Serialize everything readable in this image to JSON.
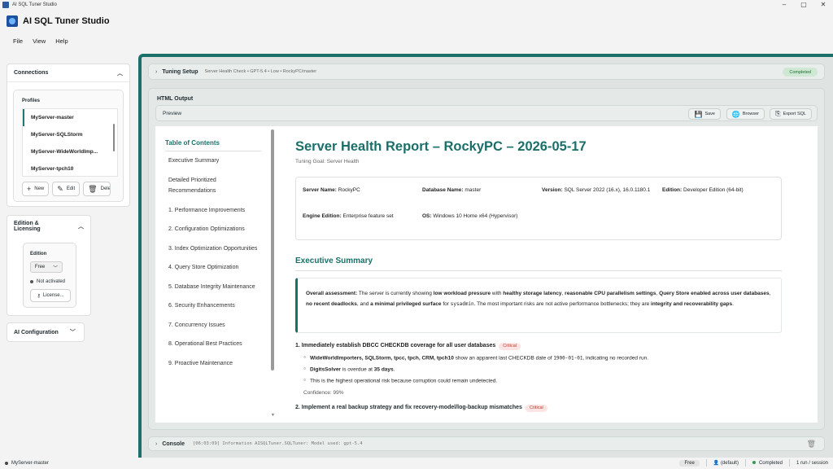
{
  "window": {
    "title": "AI SQL Tuner Studio",
    "controls": [
      "–",
      "▢",
      "✕"
    ]
  },
  "app": {
    "name": "AI SQL Tuner Studio"
  },
  "menu": [
    "File",
    "View",
    "Help"
  ],
  "connections": {
    "title": "Connections",
    "profiles_label": "Profiles",
    "profiles": [
      "MyServer-master",
      "MyServer-SQLStorm",
      "MyServer-WideWorldImp...",
      "MyServer-tpch10"
    ],
    "selected": "MyServer-master",
    "buttons": {
      "new": "New",
      "edit": "Edit",
      "delete": "Dele"
    }
  },
  "edition": {
    "title": "Edition & Licensing",
    "label": "Edition",
    "value": "Free",
    "status": "Not activated",
    "license_button": "License..."
  },
  "ai_config": {
    "title": "AI Configuration"
  },
  "tuning": {
    "title": "Tuning Setup",
    "summary": "Server Health Check • GPT-5.4 • Low • RockyPC/master",
    "status": "Completed"
  },
  "html_output": {
    "title": "HTML Output",
    "preview_label": "Preview",
    "buttons": {
      "save": "Save",
      "browser": "Browser",
      "export": "Export SQL"
    }
  },
  "toc": {
    "title": "Table of Contents",
    "items": [
      "Executive Summary",
      "Detailed Prioritized Recommendations",
      "1. Performance Improvements",
      "2. Configuration Optimizations",
      "3. Index Optimization Opportunities",
      "4. Query Store Optimization",
      "5. Database Integrity Maintenance",
      "6. Security Enhancements",
      "7. Concurrency Issues",
      "8. Operational Best Practices",
      "9. Proactive Maintenance"
    ]
  },
  "report": {
    "title": "Server Health Report – RockyPC – 2026-05-17",
    "goal": "Tuning Goal: Server Health",
    "info": {
      "server_name_label": "Server Name:",
      "server_name": "RockyPC",
      "database_name_label": "Database Name:",
      "database_name": "master",
      "version_label": "Version:",
      "version": "SQL Server 2022 (16.x), 16.0.1180.1",
      "edition_label": "Edition:",
      "edition": "Developer Edition (64-bit)",
      "engine_label": "Engine Edition:",
      "engine": "Enterprise feature set",
      "os_label": "OS:",
      "os": "Windows 10 Home x64 (Hypervisor)"
    },
    "exec_summary_heading": "Executive Summary",
    "assessment": {
      "lead": "Overall assessment:",
      "t1": " The server is currently showing ",
      "b1": "low workload pressure",
      "t2": " with ",
      "b2": "healthy storage latency",
      "t3": ", ",
      "b3": "reasonable CPU parallelism settings",
      "t4": ", ",
      "b4": "Query Store enabled across user databases",
      "t5": ", ",
      "b5": "no recent deadlocks",
      "t6": ", and ",
      "b6": "a minimal privileged surface",
      "t7": " for ",
      "code": "sysadmin",
      "t8": ". The most important risks are not active performance bottlenecks; they are ",
      "b7": "integrity and recoverability gaps",
      "t9": "."
    },
    "rec1": {
      "title": "1. Immediately establish DBCC CHECKDB coverage for all user databases",
      "badge": "Critical",
      "b1_bold": "WideWorldImporters, SQLStorm, tpcc, tpch, CRM, tpch10",
      "b1_text": " show an apparent last CHECKDB date of ",
      "b1_code": "1900-01-01",
      "b1_tail": ", indicating no recorded run.",
      "b2_bold": "DigitsSolver",
      "b2_text": " is overdue at ",
      "b2_bold2": "35 days",
      "b2_tail": ".",
      "b3": "This is the highest operational risk because corruption could remain undetected.",
      "confidence": "Confidence: 99%"
    },
    "rec2": {
      "title": "2. Implement a real backup strategy and fix recovery-model/log-backup mismatches",
      "badge": "Critical"
    }
  },
  "console": {
    "title": "Console",
    "log": "[06:03:09] Information AISQLTuner.SQLTuner: Model used: gpt-5.4"
  },
  "statusbar": {
    "connection": "MyServer-master",
    "edition": "Free",
    "user": "(default)",
    "state": "Completed",
    "usage": "1 run / session"
  },
  "colors": {
    "accent": "#1b6f68",
    "critical": "#c0392b",
    "success": "#2e9e47"
  }
}
